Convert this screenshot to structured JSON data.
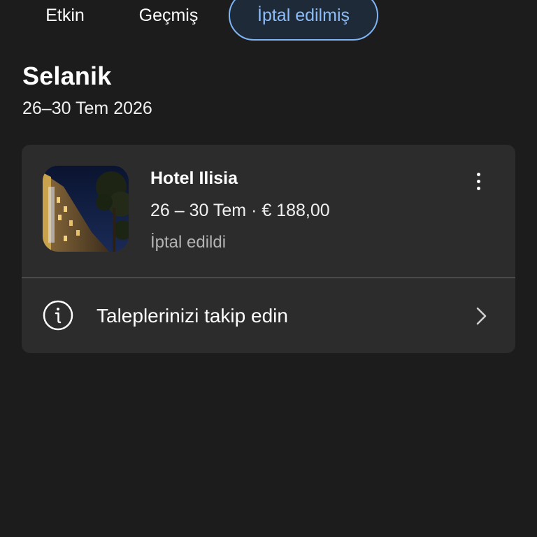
{
  "tabs": [
    {
      "label": "Etkin"
    },
    {
      "label": "Geçmiş"
    },
    {
      "label": "İptal edilmiş",
      "active": true
    }
  ],
  "trip": {
    "city": "Selanik",
    "dates": "26–30 Tem 2026"
  },
  "booking": {
    "hotel_name": "Hotel Ilisia",
    "meta": "26 – 30 Tem · € 188,00",
    "status": "İptal edildi",
    "thumbnail_icon": "hotel-photo"
  },
  "track": {
    "label": "Taleplerinizi takip edin",
    "icon": "info-circle-icon"
  },
  "colors": {
    "background": "#1c1c1c",
    "card": "#2c2c2c",
    "active_tab_border": "#7fb4f5",
    "active_tab_text": "#8cbcf7",
    "muted_text": "#b3b3b3"
  }
}
